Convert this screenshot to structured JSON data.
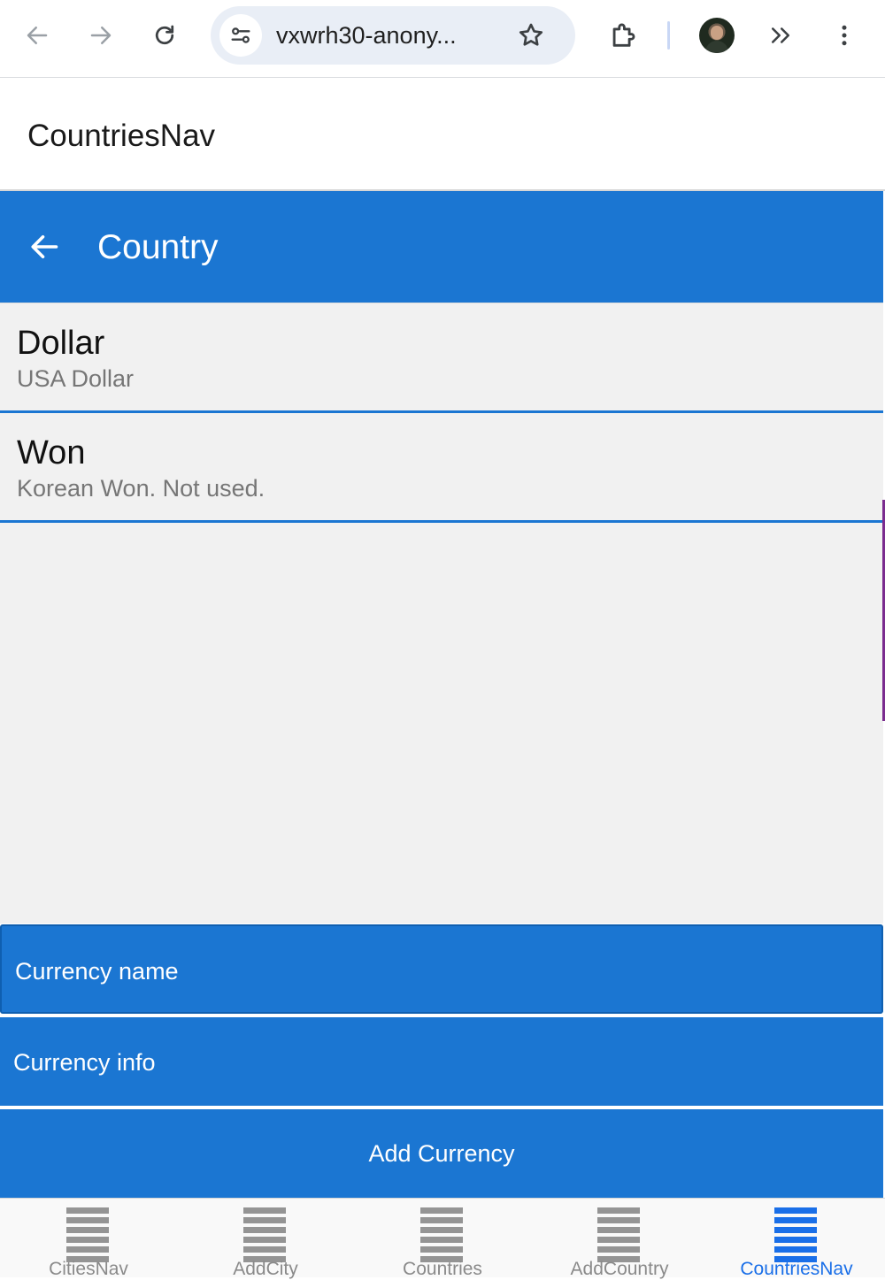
{
  "browser": {
    "url": "vxwrh30-anony...",
    "icons": [
      "back-arrow-icon",
      "forward-arrow-icon",
      "reload-icon",
      "tune-icon",
      "star-icon",
      "extensions-icon",
      "avatar",
      "chevron-double-right-icon",
      "kebab-menu-icon"
    ]
  },
  "app": {
    "title": "CountriesNav"
  },
  "toolbar": {
    "title": "Country"
  },
  "currencies": [
    {
      "name": "Dollar",
      "info": "USA Dollar"
    },
    {
      "name": "Won",
      "info": "Korean Won. Not used."
    }
  ],
  "form": {
    "name_placeholder": "Currency name",
    "info_placeholder": "Currency info",
    "add_label": "Add Currency"
  },
  "tabs": [
    {
      "label": "CitiesNav",
      "active": false
    },
    {
      "label": "AddCity",
      "active": false
    },
    {
      "label": "Countries",
      "active": false
    },
    {
      "label": "AddCountry",
      "active": false
    },
    {
      "label": "CountriesNav",
      "active": true
    }
  ],
  "colors": {
    "primary": "#1b76d2",
    "active_tab": "#1a6fe8",
    "inactive_tab": "#949494",
    "list_bg": "#f1f1f1"
  }
}
